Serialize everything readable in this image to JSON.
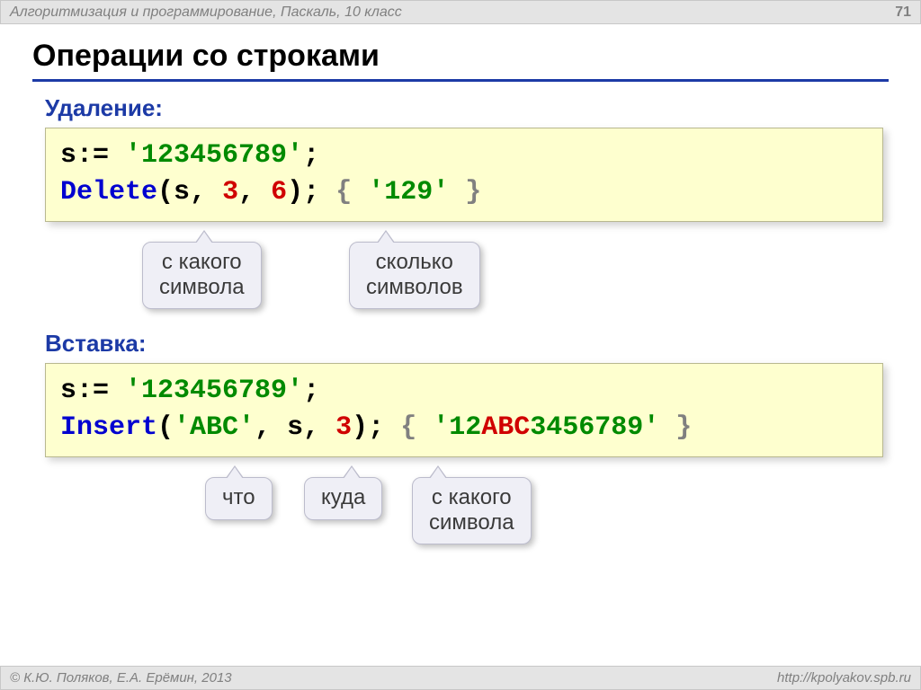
{
  "top": {
    "breadcrumb": "Алгоритмизация и программирование, Паскаль, 10 класс",
    "page": "71"
  },
  "title": "Операции со строками",
  "delete": {
    "heading": "Удаление:",
    "code": {
      "l1_var": "s",
      "l1_assign": ":= ",
      "l1_str": "'123456789'",
      "l1_semi": ";",
      "l2_fn": "Delete",
      "l2_open": "(",
      "l2_a1": "s",
      "l2_c1": ",",
      "l2_a2": "3",
      "l2_c2": ",",
      "l2_a3": "6",
      "l2_close": ")",
      "l2_semi": ";",
      "l2_cmt_open": "{ ",
      "l2_cmt_body": "'129'",
      "l2_cmt_close": " }"
    },
    "callouts": {
      "from": "с какого\nсимвола",
      "count": "сколько\nсимволов"
    }
  },
  "insert": {
    "heading": "Вставка:",
    "code": {
      "l1_var": "s",
      "l1_assign": ":= ",
      "l1_str": "'123456789'",
      "l1_semi": ";",
      "l2_fn": "Insert",
      "l2_open": "(",
      "l2_a1": "'ABC'",
      "l2_c1": ",",
      "l2_a2": "s",
      "l2_c2": ",",
      "l2_a3": "3",
      "l2_close": ")",
      "l2_semi": ";",
      "l2_cmt_open": "{ ",
      "l2_cmt_p1": "'12",
      "l2_cmt_ins": "ABC",
      "l2_cmt_p2": "3456789'",
      "l2_cmt_close": " }"
    },
    "callouts": {
      "what": "что",
      "where": "куда",
      "from": "с какого\nсимвола"
    }
  },
  "footer": {
    "copyright": "© К.Ю. Поляков, Е.А. Ерёмин, 2013",
    "url": "http://kpolyakov.spb.ru"
  }
}
